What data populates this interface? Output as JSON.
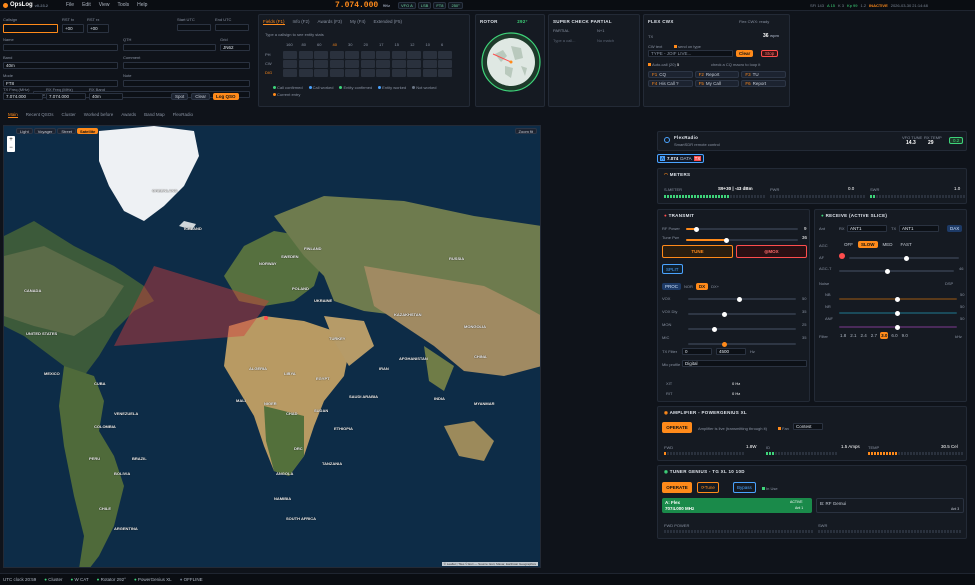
{
  "app": {
    "name": "OpsLog",
    "version": "v0.23.2"
  },
  "menu": [
    "File",
    "Edit",
    "View",
    "Tools",
    "Help"
  ],
  "vfo": {
    "frequency": "7.074.000",
    "unit": "MHz"
  },
  "top_pills": [
    "VFO A",
    "LSB",
    "FT8",
    "250°"
  ],
  "top_stats": {
    "sfi": "SFI 143",
    "a": "A 15",
    "k": "K 3",
    "kp": "Kp 99",
    "kval": "1.2",
    "status": "INACTIVE",
    "clock": "2026-03-30 21:14:48"
  },
  "qso": {
    "callsign_label": "Callsign",
    "rst_tx_label": "RST tx",
    "rst_tx": "+00",
    "rst_rx_label": "RST rx",
    "rst_rx": "+00",
    "start_label": "Start UTC",
    "end_label": "End UTC",
    "name_label": "Name",
    "qth_label": "QTH",
    "grid_label": "Grid",
    "grid": "JN62",
    "band_label": "Band",
    "band": "40m",
    "comment_label": "Comment",
    "mode_label": "Mode",
    "mode": "FT8",
    "note_label": "Note",
    "country_label": "Country",
    "country_placeholder": "Country",
    "tx_freq_label": "TX Freq (MHz)",
    "tx_freq": "7.074.000",
    "rx_freq_label": "RX Freq (MHz)",
    "rx_freq": "7.074.000",
    "rx_band_label": "RX Band",
    "rx_band": "40m",
    "spot_label": "Spot",
    "clear_label": "Clear",
    "log_label": "Log QSO"
  },
  "bandmap": {
    "tabs": [
      "Fields (F1)",
      "Info (F2)",
      "Awards (F3)",
      "My (F4)",
      "Extended (F5)"
    ],
    "hint": "Type a callsign to see entity stats",
    "bands": [
      "160",
      "80",
      "60",
      "40",
      "30",
      "20",
      "17",
      "15",
      "12",
      "10",
      "6"
    ],
    "rows": [
      "PH",
      "CW",
      "DIG"
    ],
    "legend": [
      "Call confirmed",
      "Call worked",
      "Entity confirmed",
      "Entity worked",
      "Not worked",
      "Current entry"
    ]
  },
  "rotor": {
    "title": "ROTOR",
    "heading": "292°"
  },
  "supercheck": {
    "title": "SUPER CHECK PARTIAL",
    "col1": "PARTIAL",
    "col2": "N+1",
    "placeholder": "Type a call...",
    "empty": "No match"
  },
  "flexcw": {
    "title": "FLEX CWX",
    "status": "Flex CWX: ready",
    "tx_label": "TX",
    "wpm": "36",
    "wpm_unit": "wpm",
    "cw_text_label": "CW text",
    "send_on_type": "send on type",
    "placeholder": "TYPE - JOIF LIVE...",
    "clear_label": "Clear",
    "stop_label": "Stop",
    "autocall_label": "Auto-call",
    "autocall_val": "(20)",
    "autocall_sec": "5",
    "autocall_hint": "check a CQ macro to loop it",
    "macros": [
      "F1 CQ",
      "F2 Report",
      "F3 TU",
      "F4 His Call ?",
      "F5 My Call",
      "F6 Report"
    ]
  },
  "main_tabs": [
    "Main",
    "Recent QSOs",
    "Cluster",
    "Worked before",
    "Awards",
    "Band Map",
    "FlexRadio"
  ],
  "map": {
    "layers": [
      "Light",
      "Voyager",
      "Street",
      "Satellite"
    ],
    "zoom_fit": "Zoom fit",
    "attribution": "© Leaflet | Tiles © Esri — Source: Esri, Maxar, Earthstar Geographics",
    "labels": [
      "GREENLAND",
      "ICELAND",
      "CANADA",
      "UNITED STATES",
      "MEXICO",
      "CUBA",
      "VENEZUELA",
      "COLOMBIA",
      "PERU",
      "BRAZIL",
      "BOLIVIA",
      "CHILE",
      "ARGENTINA",
      "SWEDEN",
      "FINLAND",
      "NORWAY",
      "RUSSIA",
      "KAZAKHSTAN",
      "MONGOLIA",
      "CHINA",
      "INDIA",
      "TURKEY",
      "IRAN",
      "SAUDI ARABIA",
      "EGYPT",
      "LIBYA",
      "ALGERIA",
      "MALI",
      "NIGER",
      "SUDAN",
      "CHAD",
      "ETHIOPIA",
      "DRC",
      "ANGOLA",
      "NAMIBIA",
      "SOUTH AFRICA",
      "TANZANIA",
      "MYANMAR",
      "AFGHANISTAN",
      "POLAND",
      "UKRAINE"
    ]
  },
  "flex": {
    "title": "FlexRadio",
    "subtitle": "SmartSDR remote control",
    "vfo_label": "VFO TUNE",
    "vfo_val": "14.3",
    "rx_label": "RX TEMP",
    "rx_val": "29",
    "ok": "0.2",
    "slice_badge": "A",
    "slice_freq": "7.074",
    "slice_mode": "DATA",
    "slice_tag": "TX"
  },
  "meters": {
    "title": "METERS",
    "smeter_label": "S-METER",
    "smeter": "S9+30 | -43 dBm",
    "pwr_label": "PWR",
    "pwr": "0.0",
    "swr_label": "SWR",
    "swr": "1.0"
  },
  "transmit": {
    "title": "TRANSMIT",
    "rf_label": "RF Power",
    "rf": "9",
    "rf_pct": 0.09,
    "tune_label": "Tune Pwr",
    "tune_val": "36",
    "tune_pct": 0.36,
    "tune_btn": "TUNE",
    "mox_btn": "MOX",
    "split_btn": "SPLIT",
    "proc": "PROC",
    "nor": "NOR",
    "dx": "DX",
    "dxplus": "DX+",
    "rows": [
      {
        "l": "VOX",
        "v": "50"
      },
      {
        "l": "VOX Dly",
        "v": "35"
      },
      {
        "l": "MON",
        "v": "25"
      },
      {
        "l": "MIC",
        "v": "35"
      }
    ],
    "txfilter_label": "TX Filter",
    "txfilter_lo": "0",
    "txfilter_hi": "4500",
    "txfilter_unit": "Hz",
    "mic_profile_label": "Mic profile",
    "mic_profile": "Digital",
    "xit_label": "XIT",
    "xit": "0 Hz",
    "rit_label": "RIT",
    "rit": "0 Hz"
  },
  "receive": {
    "title": "RECEIVE (ACTIVE SLICE)",
    "ant_label": "Ant",
    "rx_label": "RX",
    "rx_ant": "ANT1",
    "tx_label": "TX",
    "tx_ant": "ANT1",
    "dax": "DAX",
    "agc_label": "AGC",
    "agc_opts": [
      "OFF",
      "SLOW",
      "MED",
      "FAST"
    ],
    "af_label": "AF",
    "agct_label": "AGC-T",
    "agct": "46",
    "noise_label": "Noise",
    "noise_val": "DSP",
    "nb_label": "NB",
    "nr_label": "NR",
    "anf_label": "ANF",
    "nb": "50",
    "nr": "50",
    "anf": "50",
    "filter_label": "Filter",
    "filters": [
      "1.8",
      "2.1",
      "2.4",
      "2.7",
      "3.0",
      "6.0",
      "9.0"
    ],
    "filter_unit": "kHz"
  },
  "amp": {
    "title": "AMPLIFIER - POWERGENIUS XL",
    "operate": "OPERATE",
    "note": "Amplifier is live (transmitting through it)",
    "fan": "Fan",
    "fan_mode": "Contest",
    "fwd_label": "FWD",
    "fwd": "1.8W",
    "id_label": "ID",
    "id": "1.5 Amps",
    "temp_label": "TEMP",
    "temp": "30.5 Cel"
  },
  "tuner": {
    "title": "TUNER GENIUS - TG XL 10 10D",
    "operate": "OPERATE",
    "tune": "Tune",
    "bypass": "Bypass",
    "in_use": "In Use",
    "a_label": "A: Flex",
    "a_freq": "7074.000 MHz",
    "a_badge": "ACTIVE",
    "a_ant": "Ant 1",
    "b_label": "B: RF Gemui",
    "b_ant": "Ant 3",
    "fwd_label": "FWD POWER",
    "swr_label": "SWR"
  },
  "statusbar": [
    "UTC clock 20:59",
    "Cluster",
    "W CAT",
    "Rotator 292°",
    "PowerGenius XL",
    "OFFLINE"
  ],
  "colors": {
    "accent": "#ff8a1a",
    "ok": "#3ed47a",
    "bad": "#ff4d4d",
    "bg": "#0f131a"
  }
}
